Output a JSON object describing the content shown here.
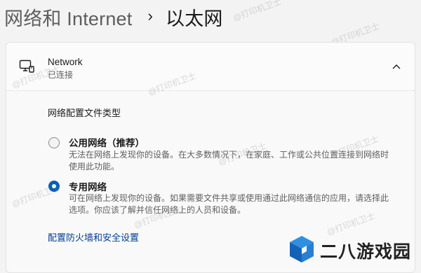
{
  "breadcrumb": {
    "parent": "网络和 Internet",
    "separator": "›",
    "current": "以太网"
  },
  "network": {
    "icon": "network-monitor-icon",
    "name": "Network",
    "status": "已连接",
    "collapse_icon": "chevron-up-icon"
  },
  "profile": {
    "title": "网络配置文件类型",
    "options": [
      {
        "label": "公用网络（推荐）",
        "description": "无法在网络上发现你的设备。在大多数情况下，在家庭、工作或公共位置连接到网络时使用此功能。",
        "selected": false
      },
      {
        "label": "专用网络",
        "description": "可在网络上发现你的设备。如果需要文件共享或使用通过此网络通信的应用，请选择此选项。你应该了解并信任网络上的人员和设备。",
        "selected": true
      }
    ]
  },
  "firewall_link": "配置防火墙和安全设置",
  "watermark": "@打印机卫士",
  "brand": {
    "name": "二八游戏园",
    "logo": "cube-logo-icon"
  },
  "colors": {
    "accent": "#005fb8",
    "link": "#003e92"
  }
}
